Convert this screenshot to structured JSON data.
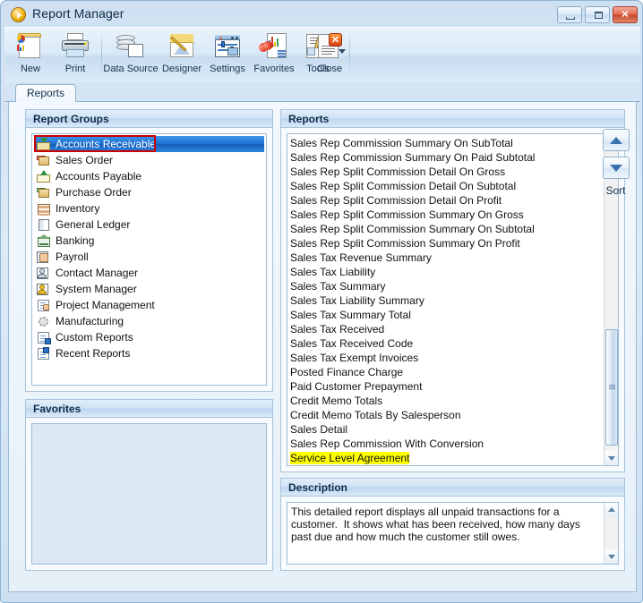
{
  "window": {
    "title": "Report Manager",
    "icon": "play-circle-icon",
    "controls": {
      "minimize": "Minimize",
      "maximize": "Maximize",
      "close": "Close"
    }
  },
  "toolbar": {
    "buttons": [
      {
        "label": "New",
        "icon": "new-report-icon"
      },
      {
        "label": "Print",
        "icon": "printer-icon"
      },
      {
        "label": "Data Source",
        "icon": "database-icon"
      },
      {
        "label": "Designer",
        "icon": "designer-pencil-icon"
      },
      {
        "label": "Settings",
        "icon": "settings-sliders-icon"
      },
      {
        "label": "Favorites",
        "icon": "heart-chart-icon"
      },
      {
        "label": "Tools",
        "icon": "tools-wrench-icon"
      },
      {
        "label": "Close",
        "icon": "close-document-icon"
      }
    ],
    "tools_has_dropdown": true
  },
  "tabs": [
    {
      "label": "Reports",
      "active": true
    }
  ],
  "report_groups": {
    "title": "Report Groups",
    "selected_index": 0,
    "items": [
      {
        "label": "Accounts Receivable",
        "icon": "receivable-envelope-icon"
      },
      {
        "label": "Sales Order",
        "icon": "sales-order-box-icon"
      },
      {
        "label": "Accounts Payable",
        "icon": "payable-envelope-icon"
      },
      {
        "label": "Purchase Order",
        "icon": "purchase-order-box-icon"
      },
      {
        "label": "Inventory",
        "icon": "inventory-grid-icon"
      },
      {
        "label": "General Ledger",
        "icon": "ledger-book-icon"
      },
      {
        "label": "Banking",
        "icon": "bank-building-icon"
      },
      {
        "label": "Payroll",
        "icon": "payroll-hand-icon"
      },
      {
        "label": "Contact Manager",
        "icon": "contact-person-icon"
      },
      {
        "label": "System Manager",
        "icon": "system-manager-icon"
      },
      {
        "label": "Project Management",
        "icon": "project-management-icon"
      },
      {
        "label": "Manufacturing",
        "icon": "manufacturing-gear-icon"
      },
      {
        "label": "Custom Reports",
        "icon": "custom-reports-icon"
      },
      {
        "label": "Recent Reports",
        "icon": "recent-reports-icon"
      }
    ]
  },
  "favorites": {
    "title": "Favorites",
    "items": []
  },
  "reports": {
    "title": "Reports",
    "highlighted_item": "Service Level Agreement",
    "highlight_color": "#ffff00",
    "items": [
      "Sales Rep Commission Summary On SubTotal",
      "Sales Rep Commission Summary On Paid Subtotal",
      "Sales Rep Split Commission Detail On Gross",
      "Sales Rep Split Commission Detail On Subtotal",
      "Sales Rep Split Commission Detail On Profit",
      "Sales Rep Split Commission Summary On Gross",
      "Sales Rep Split Commission Summary On Subtotal",
      "Sales Rep Split Commission Summary On Profit",
      "Sales Tax Revenue Summary",
      "Sales Tax Liability",
      "Sales Tax Summary",
      "Sales Tax Liability Summary",
      "Sales Tax Summary Total",
      "Sales Tax Received",
      "Sales Tax Received Code",
      "Sales Tax Exempt Invoices",
      "Posted Finance Charge",
      "Paid Customer Prepayment",
      "Credit Memo Totals",
      "Credit Memo Totals By Salesperson",
      "Sales Detail",
      "Sales Rep Commission With Conversion",
      "Service Level Agreement"
    ]
  },
  "sort": {
    "label": "Sort",
    "up_icon": "sort-up-icon",
    "down_icon": "sort-down-icon"
  },
  "description": {
    "title": "Description",
    "text": "This detailed report displays all unpaid transactions for a customer.  It shows what has been received, how many days past due and how much the customer still owes."
  },
  "annotations": {
    "selection_rect_color": "#cc0000",
    "highlight_color": "#ffff00"
  }
}
